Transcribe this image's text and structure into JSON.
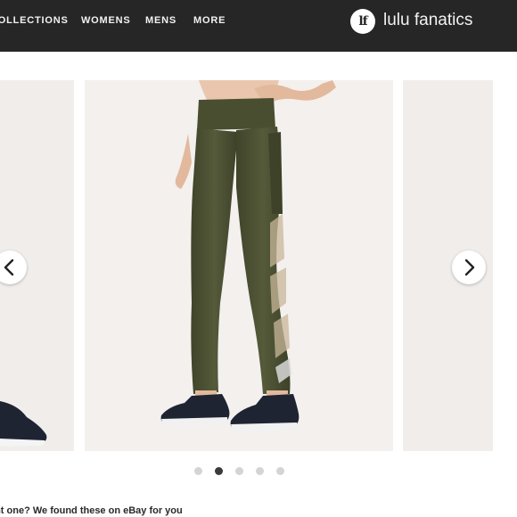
{
  "header": {
    "nav": [
      "COLLECTIONS",
      "WOMENS",
      "MENS",
      "MORE"
    ],
    "logo_mark": "lf",
    "brand": "lulu fanatics"
  },
  "carousel": {
    "dots": 5,
    "active_index": 1
  },
  "caption": "Want one? We found these on eBay for you",
  "colors": {
    "topbar": "#262626",
    "legging": "#4b4f33",
    "shoe": "#1f2433",
    "dot_active": "#3a3a3a",
    "dot_inactive": "#d4d4d4"
  }
}
